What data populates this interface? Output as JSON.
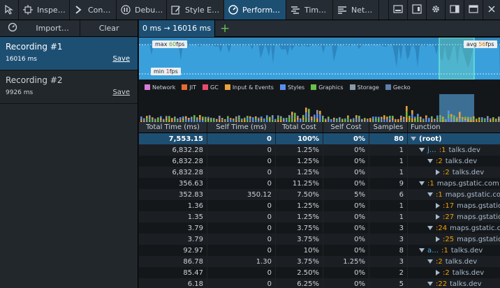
{
  "tabs": [
    {
      "icon": "cursor-icon",
      "label": ""
    },
    {
      "icon": "inspector-icon",
      "label": "Inspe…"
    },
    {
      "icon": "console-icon",
      "label": "Con…"
    },
    {
      "icon": "debugger-icon",
      "label": "Debu…"
    },
    {
      "icon": "style-editor-icon",
      "label": "Style E…"
    },
    {
      "icon": "performance-icon",
      "label": "Perform…",
      "selected": true
    },
    {
      "icon": "timeline-icon",
      "label": "Tim…"
    },
    {
      "icon": "network-icon",
      "label": "Net…"
    }
  ],
  "sidebar": {
    "import_label": "Import…",
    "clear_label": "Clear",
    "recordings": [
      {
        "title": "Recording #1",
        "duration": "16016 ms",
        "save": "Save",
        "selected": true
      },
      {
        "title": "Recording #2",
        "duration": "9926 ms",
        "save": "Save",
        "selected": false
      }
    ]
  },
  "toolbar": {
    "range": "0 ms → 16016 ms",
    "add": "+"
  },
  "fps": {
    "max_label": "max",
    "max_value": "60",
    "max_unit": "fps",
    "min_label": "min",
    "min_value": "1",
    "min_unit": "fps",
    "avg_label": "avg",
    "avg_value": "56",
    "avg_unit": "fps"
  },
  "legend": [
    {
      "name": "Network",
      "color": "#d67bd6"
    },
    {
      "name": "JIT",
      "color": "#e86a2e"
    },
    {
      "name": "GC",
      "color": "#ea4b6c"
    },
    {
      "name": "Input & Events",
      "color": "#e8a23c"
    },
    {
      "name": "Styles",
      "color": "#5a8ff0"
    },
    {
      "name": "Graphics",
      "color": "#6bbf4a"
    },
    {
      "name": "Storage",
      "color": "#8a99a8"
    },
    {
      "name": "Gecko",
      "color": "#5f7fa8"
    }
  ],
  "table": {
    "headers": [
      "Total Time (ms)",
      "Self Time (ms)",
      "Total Cost",
      "Self Cost",
      "Samples",
      "Function"
    ],
    "rows": [
      {
        "total": "7,553.15",
        "self": "0",
        "tcost": "100%",
        "scost": "0%",
        "samples": "80",
        "indent": 0,
        "open": true,
        "line": "",
        "name": "",
        "res": "(root)",
        "sel": true
      },
      {
        "total": "6,832.28",
        "self": "0",
        "tcost": "1.25%",
        "scost": "0%",
        "samples": "1",
        "indent": 1,
        "open": true,
        "line": ":1",
        "name": "j…",
        "res": "talks.dev"
      },
      {
        "total": "6,832.28",
        "self": "0",
        "tcost": "1.25%",
        "scost": "0%",
        "samples": "1",
        "indent": 2,
        "open": true,
        "line": ":2",
        "name": "",
        "res": "talks.dev"
      },
      {
        "total": "6,832.28",
        "self": "0",
        "tcost": "1.25%",
        "scost": "0%",
        "samples": "1",
        "indent": 3,
        "open": false,
        "line": ":2",
        "name": "",
        "res": "talks.dev"
      },
      {
        "total": "356.63",
        "self": "0",
        "tcost": "11.25%",
        "scost": "0%",
        "samples": "9",
        "indent": 1,
        "open": true,
        "line": ":1",
        "name": "",
        "res": "maps.gstatic.com"
      },
      {
        "total": "352.83",
        "self": "350.12",
        "tcost": "7.50%",
        "scost": "5%",
        "samples": "6",
        "indent": 2,
        "open": true,
        "line": ":1",
        "name": "",
        "res": "maps.gstatic.com"
      },
      {
        "total": "1.36",
        "self": "0",
        "tcost": "1.25%",
        "scost": "0%",
        "samples": "1",
        "indent": 3,
        "open": false,
        "line": ":17",
        "name": "",
        "res": "maps.gstatic.com"
      },
      {
        "total": "1.35",
        "self": "0",
        "tcost": "1.25%",
        "scost": "0%",
        "samples": "1",
        "indent": 3,
        "open": false,
        "line": ":27",
        "name": "",
        "res": "maps.gstatic.com"
      },
      {
        "total": "3.79",
        "self": "0",
        "tcost": "3.75%",
        "scost": "0%",
        "samples": "3",
        "indent": 2,
        "open": true,
        "line": ":24",
        "name": "",
        "res": "maps.gstatic.com"
      },
      {
        "total": "3.79",
        "self": "0",
        "tcost": "3.75%",
        "scost": "0%",
        "samples": "3",
        "indent": 3,
        "open": false,
        "line": ":25",
        "name": "",
        "res": "maps.gstatic.com"
      },
      {
        "total": "92.97",
        "self": "0",
        "tcost": "10%",
        "scost": "0%",
        "samples": "8",
        "indent": 1,
        "open": true,
        "line": ":1",
        "name": "a…",
        "res": "talks.dev"
      },
      {
        "total": "86.78",
        "self": "1.30",
        "tcost": "3.75%",
        "scost": "1.25%",
        "samples": "3",
        "indent": 2,
        "open": true,
        "line": ":2",
        "name": "",
        "res": "talks.dev"
      },
      {
        "total": "85.47",
        "self": "0",
        "tcost": "2.50%",
        "scost": "0%",
        "samples": "2",
        "indent": 3,
        "open": false,
        "line": ":2",
        "name": "",
        "res": "talks.dev"
      },
      {
        "total": "6.18",
        "self": "0",
        "tcost": "6.25%",
        "scost": "0%",
        "samples": "5",
        "indent": 2,
        "open": true,
        "line": ":22",
        "name": "",
        "res": "talks.dev"
      }
    ]
  }
}
